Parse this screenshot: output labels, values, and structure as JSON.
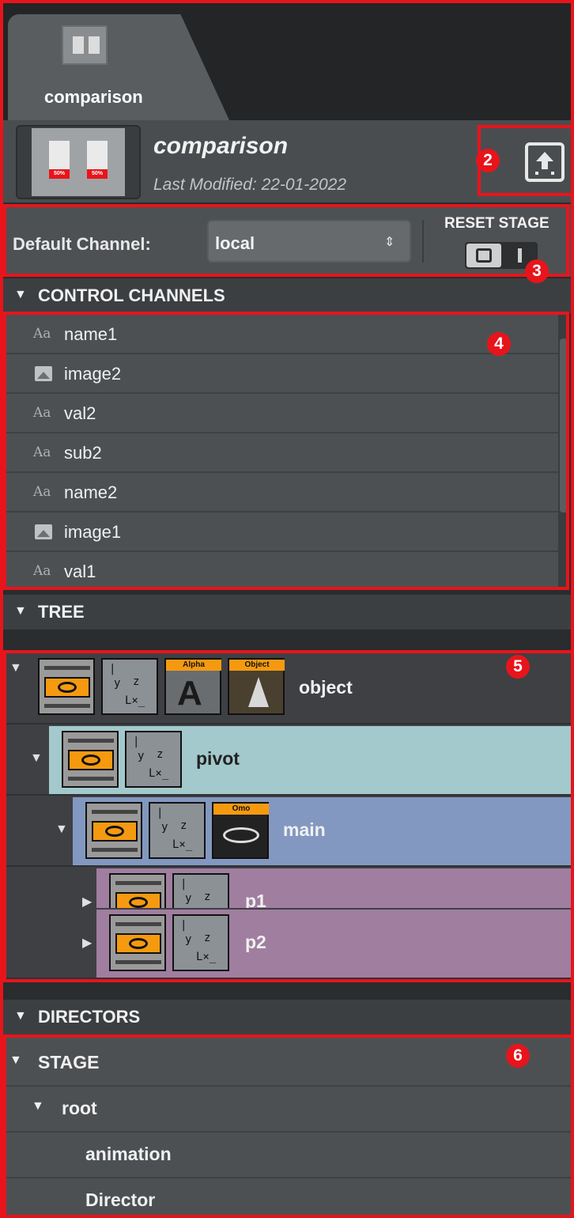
{
  "tab": {
    "label": "comparison"
  },
  "scene": {
    "name": "comparison",
    "last_modified": "Last Modified: 22-01-2022",
    "thumb_card_label": "50%"
  },
  "channel": {
    "label": "Default Channel:",
    "selected": "local",
    "reset_label": "RESET STAGE"
  },
  "sections": {
    "control_channels": "CONTROL CHANNELS",
    "tree": "TREE",
    "directors": "DIRECTORS"
  },
  "control_channels": [
    {
      "icon": "Aa",
      "type": "text",
      "name": "name1"
    },
    {
      "icon": "image-icon",
      "type": "image",
      "name": "image2"
    },
    {
      "icon": "Aa",
      "type": "text",
      "name": "val2"
    },
    {
      "icon": "Aa",
      "type": "text",
      "name": "sub2"
    },
    {
      "icon": "Aa",
      "type": "text",
      "name": "name2"
    },
    {
      "icon": "image-icon",
      "type": "image",
      "name": "image1"
    },
    {
      "icon": "Aa",
      "type": "text",
      "name": "val1"
    }
  ],
  "tree": {
    "nodes": [
      {
        "label": "object",
        "tags": [
          "Alpha",
          "Object"
        ],
        "color": "#3e4043"
      },
      {
        "label": "pivot",
        "tags": [],
        "color": "#a3c9cc"
      },
      {
        "label": "main",
        "tags": [
          "Omo"
        ],
        "color": "#8398c0"
      },
      {
        "label": "p1",
        "tags": [],
        "color": "#a07ea0"
      },
      {
        "label": "p2",
        "tags": [],
        "color": "#a07ea0"
      }
    ]
  },
  "directors": {
    "items": [
      {
        "label": "STAGE"
      },
      {
        "label": "root"
      },
      {
        "label": "animation"
      },
      {
        "label": "Director"
      }
    ]
  },
  "badges": [
    "2",
    "3",
    "4",
    "5",
    "6"
  ],
  "colors": {
    "highlight": "#e8141b",
    "accent_orange": "#f59a10"
  }
}
